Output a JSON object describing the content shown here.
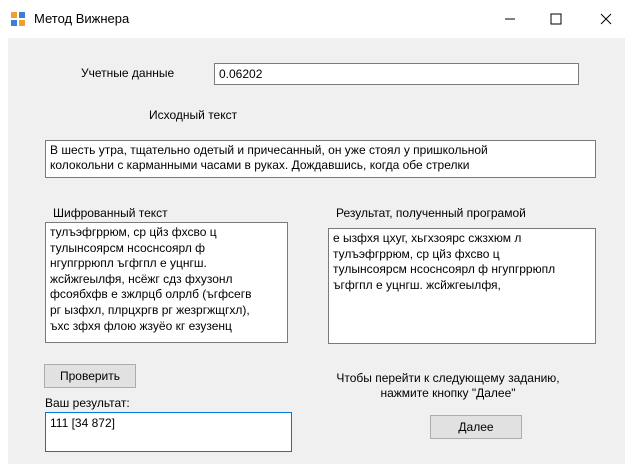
{
  "window": {
    "title": "Метод Вижнера",
    "controls": {
      "minimize_icon": "—",
      "maximize_icon": "☐",
      "close_icon": "✕"
    }
  },
  "form": {
    "credentials_label": "Учетные данные",
    "credentials_value": "0.06202",
    "source_label": "Исходный текст",
    "source_text_line1": "В шесть утра, тщательно одетый и причесанный, он уже стоял у пришкольной",
    "source_text_line2": "колокольни с карманными часами в руках. Дождавшись, когда обе стрелки",
    "cipher_label": "Шифрованный текст",
    "cipher_lines": [
      "тулъэфгррюм, ср цйз фхсво ц",
      "тулынсоярсм нсоснсоярл ф",
      "нгупгррюпл ъгфгпл е уцнгш.",
      "жсйжгеылфя, нсёжг сдз фхузонл",
      "фсоябхфв е зжлрцб олрлб (ъгфсегв",
      "рг ызфхл, плрцхргв рг жезргжщгхл),",
      "ъхс зфхя флою жзуёо кг езузенц"
    ],
    "result_label": "Результат, полученный програмой",
    "result_lines": [
      "е ызфхя цхуг, хьгхзоярс сжзхюм л",
      "тулъэфгррюм, ср цйз фхсво ц",
      "тулынсоярсм нсоснсоярл ф нгупгррюпл",
      "ъгфгпл е уцнгш. жсйжгеылфя,"
    ],
    "check_button": "Проверить",
    "your_result_label": "Ваш результат:",
    "your_result_value": "111 [34 872]",
    "next_hint_line1": "Чтобы перейти к следующему заданию,",
    "next_hint_line2": "нажмите кнопку \"Далее\"",
    "next_button": "Далее"
  },
  "colors": {
    "client_bg": "#f0f0f0",
    "focus_border": "#0078d7",
    "icon_orange": "#f0a030",
    "icon_blue": "#3c7fd0"
  }
}
